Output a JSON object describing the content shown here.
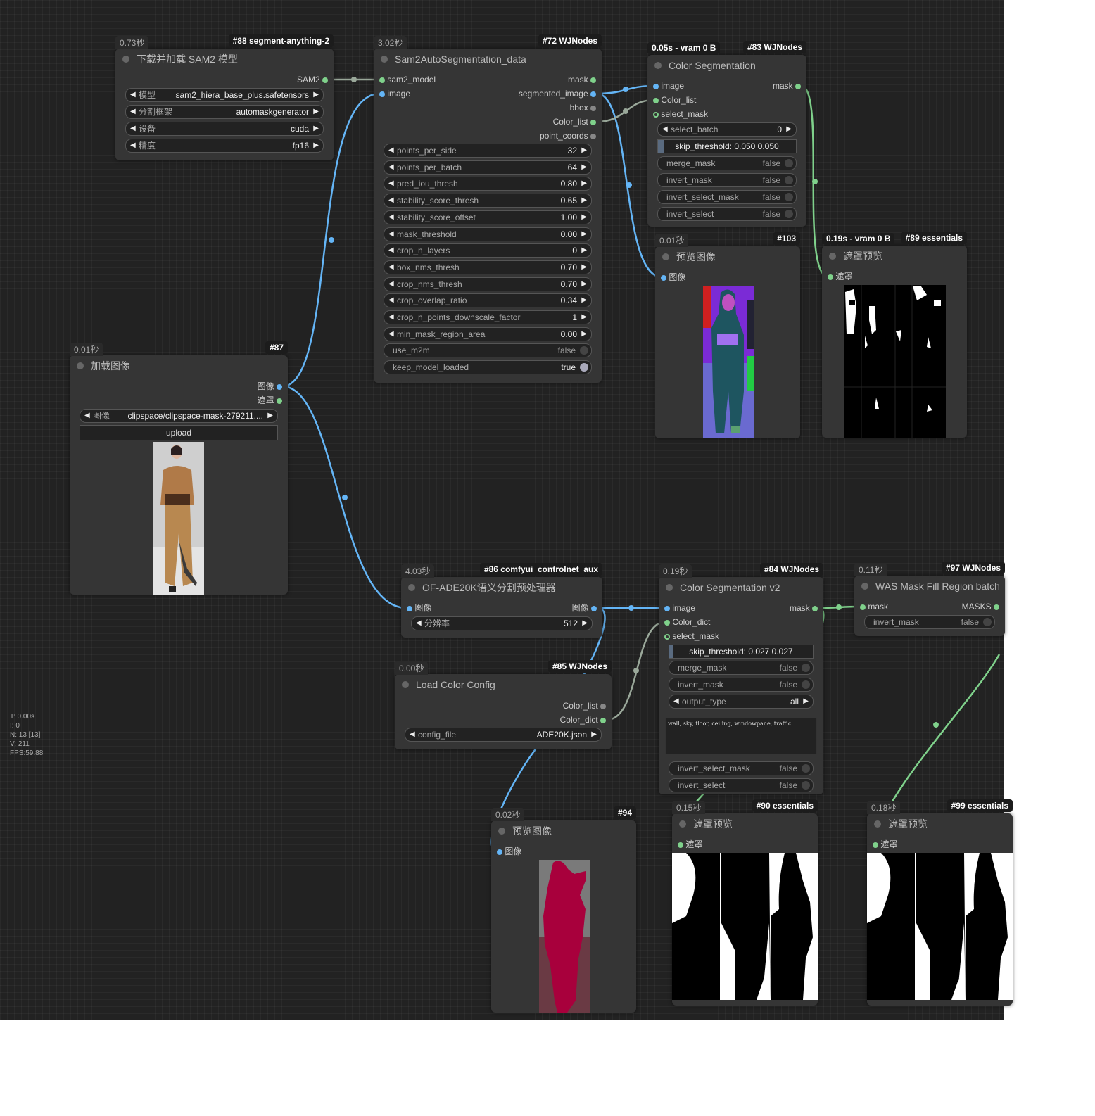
{
  "stats": {
    "t": "T: 0.00s",
    "i": "I: 0",
    "n": "N: 13 [13]",
    "v": "V: 211",
    "fps": "FPS:59.88"
  },
  "n88": {
    "time": "0.73秒",
    "id": "#88 segment-anything-2",
    "title": "下载并加载 SAM2 模型",
    "out": "SAM2",
    "w1l": "模型",
    "w1v": "sam2_hiera_base_plus.safetensors",
    "w2l": "分割框架",
    "w2v": "automaskgenerator",
    "w3l": "设备",
    "w3v": "cuda",
    "w4l": "精度",
    "w4v": "fp16"
  },
  "n72": {
    "time": "3.02秒",
    "id": "#72 WJNodes",
    "title": "Sam2AutoSegmentation_data",
    "in1": "sam2_model",
    "in2": "image",
    "out1": "mask",
    "out2": "segmented_image",
    "out3": "bbox",
    "out4": "Color_list",
    "out5": "point_coords",
    "params": [
      {
        "label": "points_per_side",
        "value": "32"
      },
      {
        "label": "points_per_batch",
        "value": "64"
      },
      {
        "label": "pred_iou_thresh",
        "value": "0.80"
      },
      {
        "label": "stability_score_thresh",
        "value": "0.65"
      },
      {
        "label": "stability_score_offset",
        "value": "1.00"
      },
      {
        "label": "mask_threshold",
        "value": "0.00"
      },
      {
        "label": "crop_n_layers",
        "value": "0"
      },
      {
        "label": "box_nms_thresh",
        "value": "0.70"
      },
      {
        "label": "crop_nms_thresh",
        "value": "0.70"
      },
      {
        "label": "crop_overlap_ratio",
        "value": "0.34"
      },
      {
        "label": "crop_n_points_downscale_factor",
        "value": "1"
      },
      {
        "label": "min_mask_region_area",
        "value": "0.00"
      }
    ],
    "t1l": "use_m2m",
    "t1v": "false",
    "t2l": "keep_model_loaded",
    "t2v": "true"
  },
  "n83": {
    "time": "0.05s - vram 0 B",
    "id": "#83 WJNodes",
    "title": "Color Segmentation",
    "in1": "image",
    "in2": "Color_list",
    "in3": "select_mask",
    "out1": "mask",
    "w1l": "select_batch",
    "w1v": "0",
    "slider": "skip_threshold: 0.050  0.050",
    "t1l": "merge_mask",
    "t1v": "false",
    "t2l": "invert_mask",
    "t2v": "false",
    "t3l": "invert_select_mask",
    "t3v": "false",
    "t4l": "invert_select",
    "t4v": "false"
  },
  "n103": {
    "time": "0.01秒",
    "id": "#103",
    "title": "预览图像",
    "in1": "图像"
  },
  "n89": {
    "time": "0.19s - vram 0 B",
    "id": "#89 essentials",
    "title": "遮罩预览",
    "in1": "遮罩"
  },
  "n87": {
    "time": "0.01秒",
    "id": "#87",
    "title": "加载图像",
    "out1": "图像",
    "out2": "遮罩",
    "w1l": "图像",
    "w1v": "clipspace/clipspace-mask-279211....",
    "upload": "upload"
  },
  "n86": {
    "time": "4.03秒",
    "id": "#86 comfyui_controlnet_aux",
    "title": "OF-ADE20K语义分割预处理器",
    "in1": "图像",
    "out1": "图像",
    "w1l": "分辨率",
    "w1v": "512"
  },
  "n85": {
    "time": "0.00秒",
    "id": "#85 WJNodes",
    "title": "Load Color Config",
    "out1": "Color_list",
    "out2": "Color_dict",
    "w1l": "config_file",
    "w1v": "ADE20K.json"
  },
  "n84": {
    "time": "0.19秒",
    "id": "#84 WJNodes",
    "title": "Color Segmentation v2",
    "in1": "image",
    "in2": "Color_dict",
    "in3": "select_mask",
    "out1": "mask",
    "slider": "skip_threshold: 0.027  0.027",
    "t1l": "merge_mask",
    "t1v": "false",
    "t2l": "invert_mask",
    "t2v": "false",
    "w1l": "output_type",
    "w1v": "all",
    "text": "wall, sky, floor, ceiling, windowpane, traffic",
    "t3l": "invert_select_mask",
    "t3v": "false",
    "t4l": "invert_select",
    "t4v": "false"
  },
  "n97": {
    "time": "0.11秒",
    "id": "#97 WJNodes",
    "title": "WAS Mask Fill Region batch",
    "in1": "mask",
    "out1": "MASKS",
    "t1l": "invert_mask",
    "t1v": "false"
  },
  "n94": {
    "time": "0.02秒",
    "id": "#94",
    "title": "预览图像",
    "in1": "图像"
  },
  "n90": {
    "time": "0.15秒",
    "id": "#90 essentials",
    "title": "遮罩预览",
    "in1": "遮罩"
  },
  "n99": {
    "time": "0.18秒",
    "id": "#99 essentials",
    "title": "遮罩预览",
    "in1": "遮罩"
  },
  "colors": {
    "link_image": "#64b5f6",
    "link_mask": "#7fd18b",
    "link_sam": "#9aa89a",
    "canvas": "#222222",
    "node": "#353535"
  }
}
